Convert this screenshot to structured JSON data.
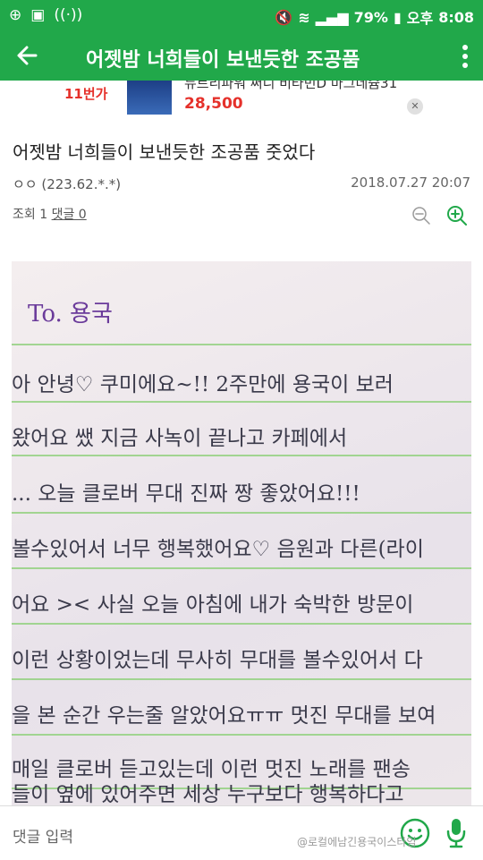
{
  "status_bar": {
    "battery": "79%",
    "period": "오후",
    "time": "8:08"
  },
  "app_bar": {
    "title": "어젯밤 너희들이 보낸듯한 조공품"
  },
  "ad": {
    "brand": "11번가",
    "title": "뉴트리파워 써니 비타민D 마그네슘31",
    "price": "28,500"
  },
  "post": {
    "title": "어젯밤 너희들이 보낸듯한 조공품 줏었다",
    "author": "ㅇㅇ (223.62.*.*)",
    "date": "2018.07.27 20:07",
    "views_label": "조회 1",
    "comments_label": "댓글 0"
  },
  "letter": {
    "to": "To. 용국",
    "lines": [
      "아 안녕♡ 쿠미에요~!!  2주만에 용국이 보러",
      "왔어요 쌨  지금 사녹이 끝나고 카페에서",
      "... 오늘 클로버 무대 진짜 짱 좋았어요!!!",
      "볼수있어서 너무 행복했어요♡ 음원과 다른(라이",
      "어요 ><  사실 오늘 아침에 내가 숙박한 방문이",
      "이런 상황이었는데 무사히 무대를 볼수있어서 다",
      "을 본 순간 우는줄 알았어요ㅠㅠ 멋진 무대를 보여",
      "매일 클로버 듣고있는데 이런 멋진 노래를 팬송",
      "들이 옆에 있어주면 세상 누구보다 행복하다고"
    ]
  },
  "bottom_bar": {
    "comment_placeholder": "댓글 입력"
  },
  "watermark": "@로컬에남긴용국이스타임",
  "colors": {
    "brand_green": "#21a84a",
    "price_red": "#e5312b"
  }
}
